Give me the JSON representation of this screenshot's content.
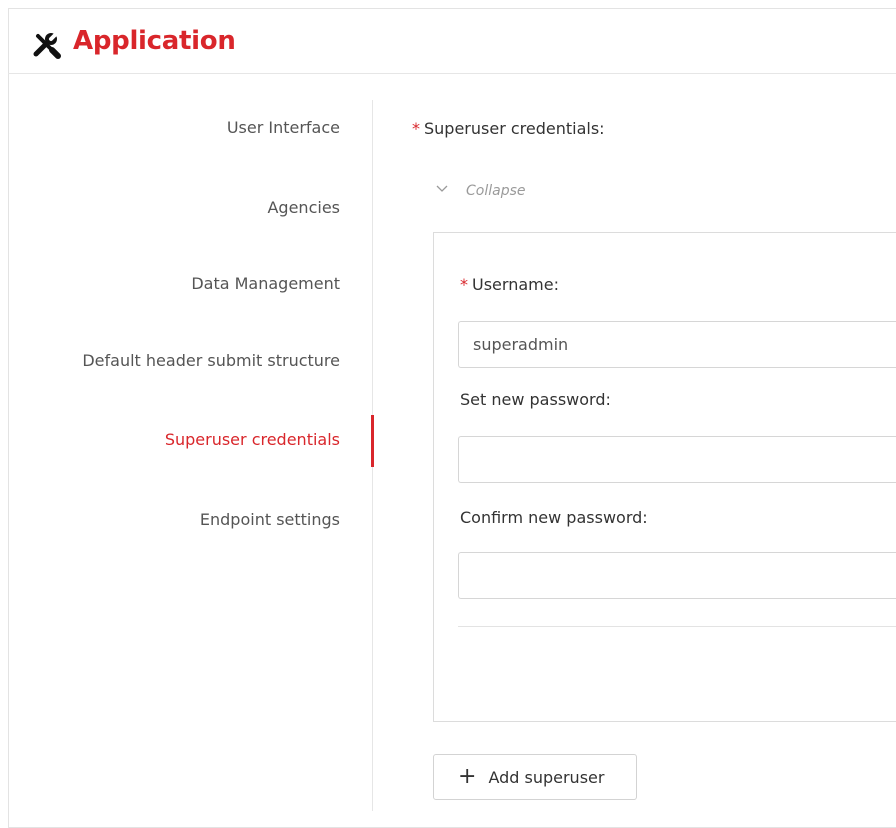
{
  "app": {
    "title": "Application",
    "icon": "tools-icon",
    "accent_color": "#d9262b"
  },
  "sidebar": {
    "items": [
      {
        "label": "User Interface",
        "active": false
      },
      {
        "label": "Agencies",
        "active": false
      },
      {
        "label": "Data Management",
        "active": false
      },
      {
        "label": "Default header submit structure",
        "active": false
      },
      {
        "label": "Superuser credentials",
        "active": true
      },
      {
        "label": "Endpoint settings",
        "active": false
      }
    ]
  },
  "form": {
    "section_label": "Superuser credentials",
    "section_label_colon": ":",
    "required_mark": "*",
    "collapse_label": "Collapse",
    "username_label": "Username",
    "username_value": "superadmin",
    "new_password_label": "Set new password",
    "new_password_value": "",
    "confirm_password_label": "Confirm new password",
    "confirm_password_value": "",
    "colon": ":",
    "add_button_label": "Add superuser",
    "add_button_icon": "plus-icon"
  }
}
